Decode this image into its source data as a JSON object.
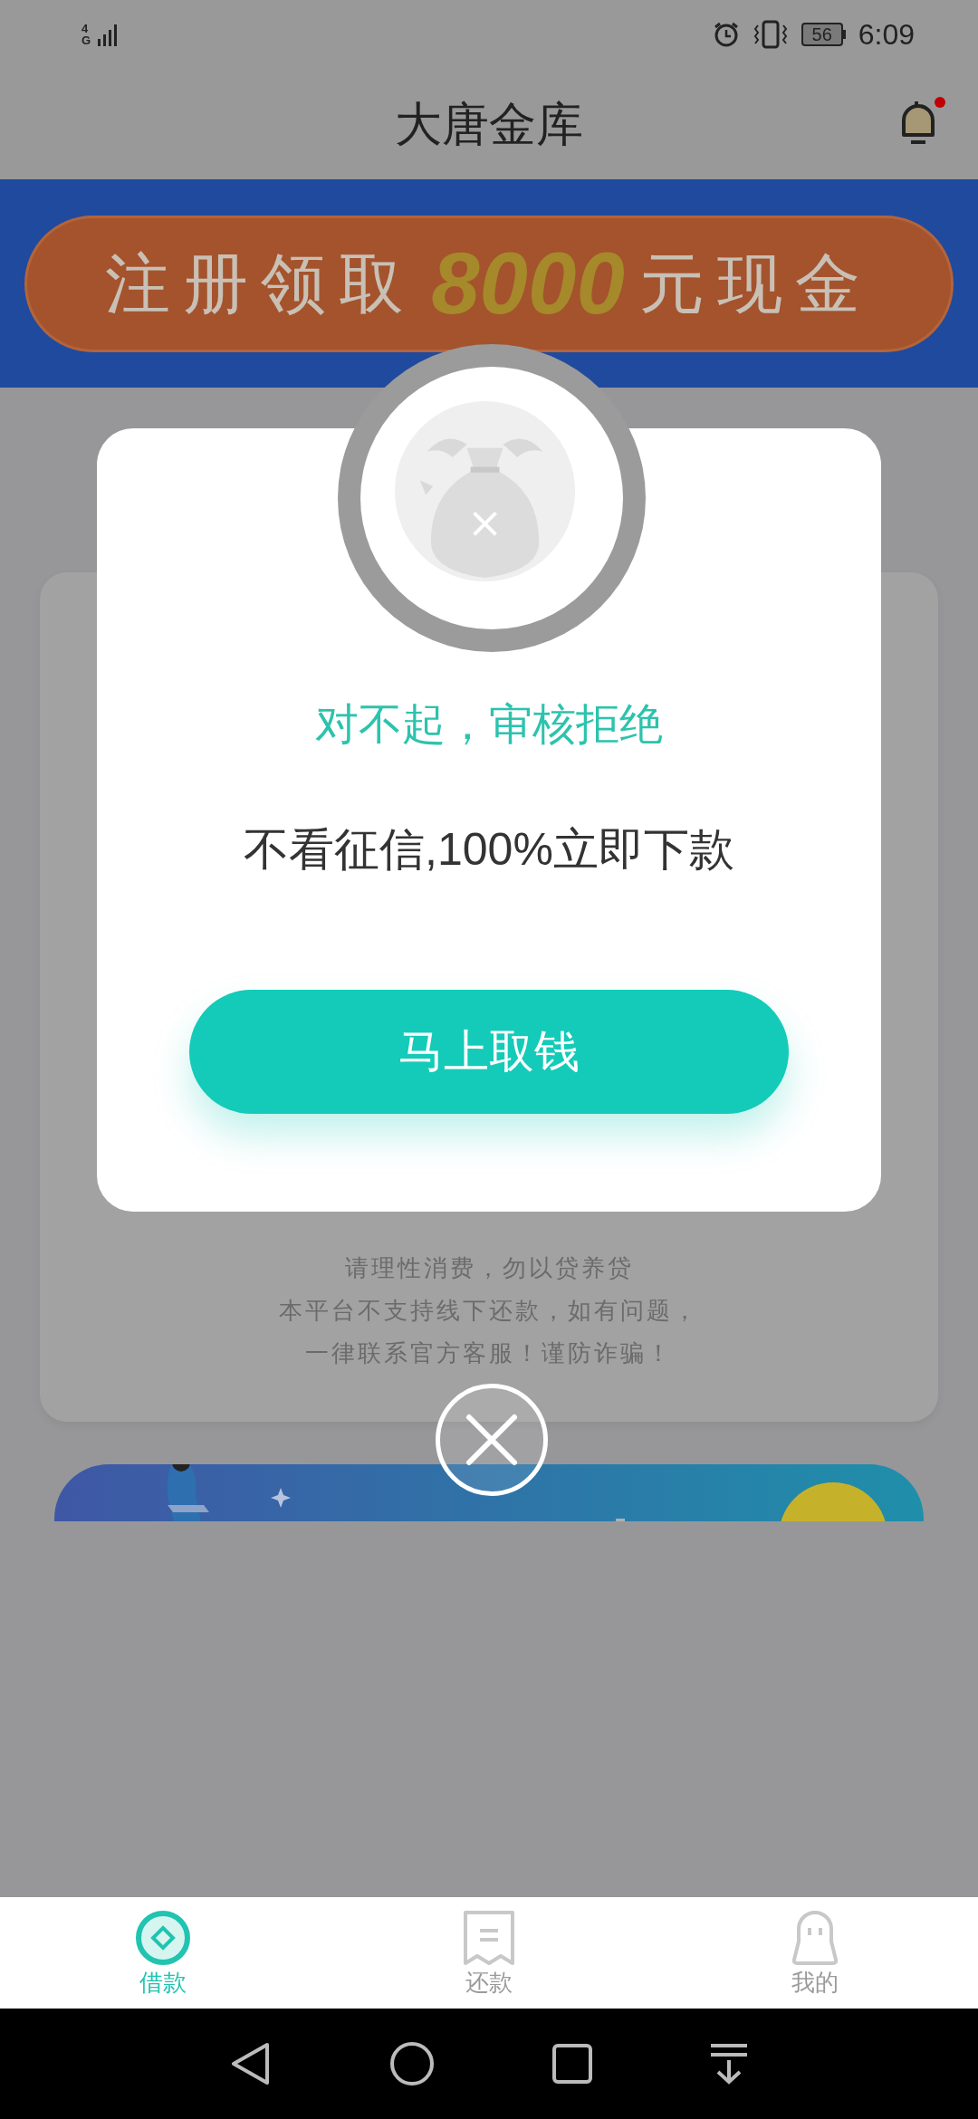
{
  "status_bar": {
    "network": "4G",
    "battery": "56",
    "time": "6:09"
  },
  "header": {
    "title": "大唐金库",
    "notification_dot": true
  },
  "promo_banner": {
    "prefix": "注册领取",
    "amount": "8000",
    "suffix": "元现金"
  },
  "notice": [
    "请理性消费，勿以贷养贷",
    "本平台不支持线下还款，如有问题，",
    "一律联系官方客服！谨防诈骗！"
  ],
  "dialog": {
    "title": "对不起，审核拒绝",
    "message": "不看征信,100%立即下款",
    "button": "马上取钱"
  },
  "tabs": [
    {
      "label": "借款",
      "kind": "loan",
      "selected": true
    },
    {
      "label": "还款",
      "kind": "repay",
      "selected": false
    },
    {
      "label": "我的",
      "kind": "profile",
      "selected": false
    }
  ]
}
